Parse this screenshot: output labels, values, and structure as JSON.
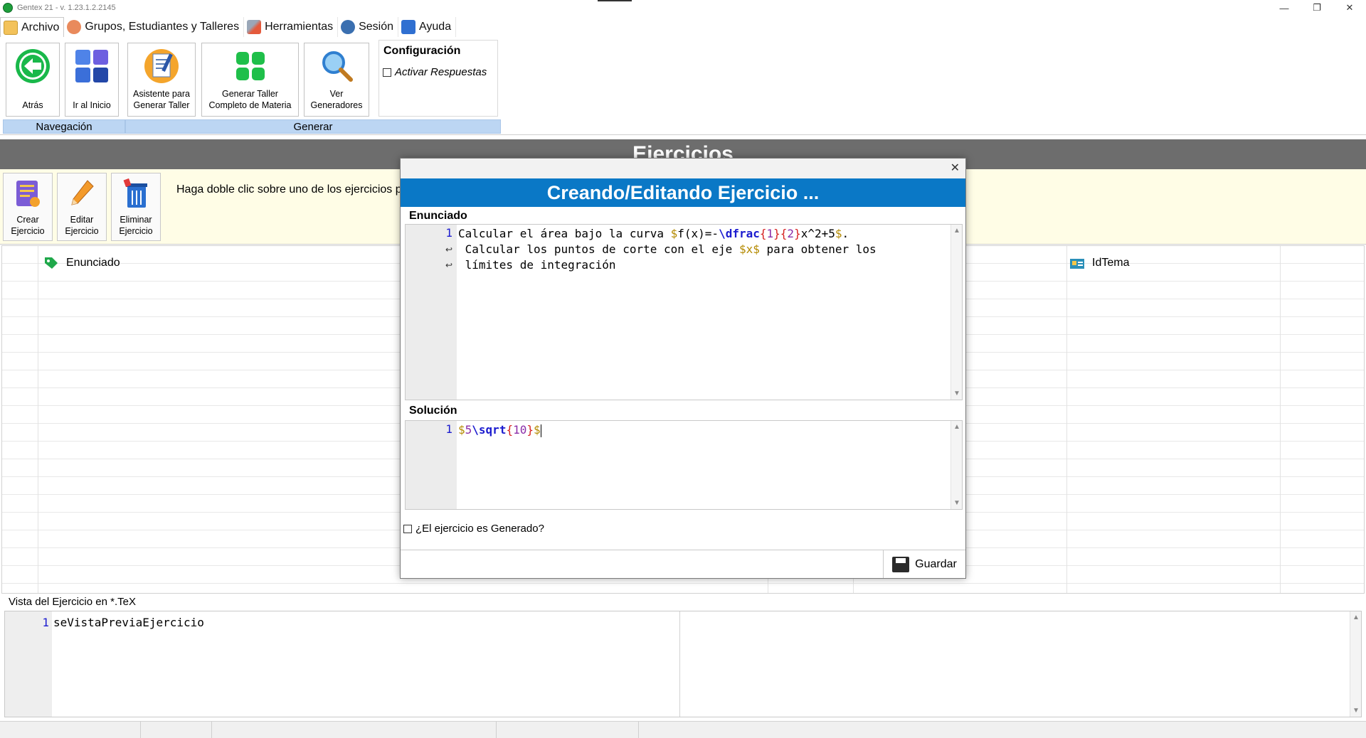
{
  "window": {
    "title": "Gentex 21 - v. 1.23.1.2.2145",
    "minimize_glyph": "—",
    "restore_glyph": "❐",
    "close_glyph": "✕"
  },
  "menu": {
    "tabs": [
      {
        "label": "Archivo",
        "icon": "folder-icon"
      },
      {
        "label": "Grupos, Estudiantes y Talleres",
        "icon": "group-icon"
      },
      {
        "label": "Herramientas",
        "icon": "tools-icon"
      },
      {
        "label": "Sesión",
        "icon": "user-icon"
      },
      {
        "label": "Ayuda",
        "icon": "help-cube-icon"
      }
    ]
  },
  "ribbon": {
    "buttons": {
      "atras": "Atrás",
      "inicio": "Ir al Inicio",
      "asistente": "Asistente para\nGenerar Taller",
      "generar": "Generar Taller\nCompleto de Materia",
      "ver": "Ver\nGeneradores"
    },
    "groups": {
      "navegacion": "Navegación",
      "generar": "Generar"
    },
    "config": {
      "title": "Configuración",
      "activar_respuestas": "Activar Respuestas"
    }
  },
  "section": {
    "title": "Ejercicios"
  },
  "toolbar": {
    "crear": "Crear\nEjercicio",
    "editar": "Editar\nEjercicio",
    "eliminar": "Eliminar\nEjercicio",
    "instruction": "Haga doble clic sobre uno de los ejercicios p"
  },
  "grid": {
    "columns": [
      "Enunciado",
      "IdTema"
    ]
  },
  "preview": {
    "label": "Vista del Ejercicio en *.TeX",
    "line_number": "1",
    "code": "seVistaPreviaEjercicio"
  },
  "modal": {
    "close_glyph": "✕",
    "title": "Creando/Editando Ejercicio ...",
    "enunciado_label": "Enunciado",
    "enunciado_line_number": "1",
    "enunciado_code": {
      "line1_text": "Calcular el área bajo la curva ",
      "line1_math_open": "$",
      "line1_math_fx": "f(x)=-",
      "line1_cmd": "\\dfrac",
      "line1_brace_open1": "{",
      "line1_arg1": "1",
      "line1_brace_close1": "}",
      "line1_brace_open2": "{",
      "line1_arg2": "2",
      "line1_brace_close2": "}",
      "line1_rest": "x^2+5",
      "line1_math_close": "$",
      "line1_end": ".",
      "line2_text": " Calcular los puntos de corte con el eje ",
      "line2_math": "$x$",
      "line2_end": " para obtener los",
      "line3_text": " límites de integración"
    },
    "solucion_label": "Solución",
    "solucion_line_number": "1",
    "solucion_code": {
      "open": "$",
      "num": "5",
      "cmd": "\\sqrt",
      "brace_open": "{",
      "arg": "10",
      "brace_close": "}",
      "close": "$"
    },
    "generado_label": "¿El ejercicio es Generado?",
    "save_label": "Guardar"
  },
  "colors": {
    "accent": "#0a78c6",
    "ribbon_group": "#bcd6f3",
    "section_bar": "#6d6d6d",
    "toolbar_bg": "#fffde6"
  }
}
